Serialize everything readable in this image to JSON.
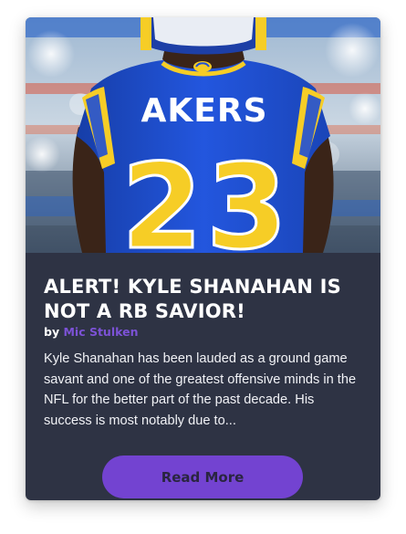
{
  "article": {
    "jersey_name": "AKERS",
    "jersey_number": "23",
    "title": "ALERT! KYLE SHANAHAN IS NOT A RB SAVIOR!",
    "by_label": "by",
    "author": "Mic Stulken",
    "excerpt": "Kyle Shanahan has been lauded as a ground game savant and one of the greatest offensive minds in the NFL for the better part of the past decade. His success is most notably due to...",
    "read_more_label": "Read More"
  },
  "colors": {
    "card_background": "#2e3344",
    "accent": "#7343d1",
    "author_link": "#7c52d6",
    "jersey_blue": "#1f4fd6",
    "jersey_yellow": "#f6cd26"
  },
  "icons": {
    "helmet_logo": "rams-horn-logo"
  }
}
